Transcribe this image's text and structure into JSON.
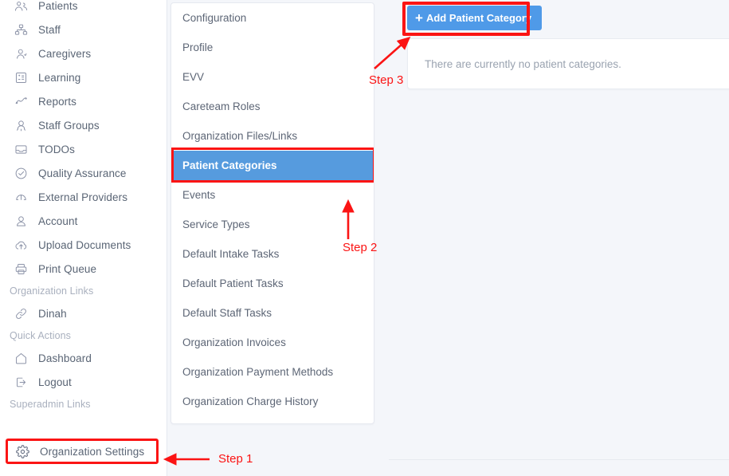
{
  "sidebar": {
    "items": [
      {
        "label": "Patients",
        "icon": "patients-icon"
      },
      {
        "label": "Staff",
        "icon": "staff-icon"
      },
      {
        "label": "Caregivers",
        "icon": "caregivers-icon"
      },
      {
        "label": "Learning",
        "icon": "learning-icon"
      },
      {
        "label": "Reports",
        "icon": "reports-icon"
      },
      {
        "label": "Staff Groups",
        "icon": "staff-groups-icon"
      },
      {
        "label": "TODOs",
        "icon": "todos-icon"
      },
      {
        "label": "Quality Assurance",
        "icon": "quality-assurance-icon"
      },
      {
        "label": "External Providers",
        "icon": "external-providers-icon"
      },
      {
        "label": "Account",
        "icon": "account-icon"
      },
      {
        "label": "Upload Documents",
        "icon": "upload-documents-icon"
      },
      {
        "label": "Print Queue",
        "icon": "print-queue-icon"
      }
    ],
    "organization_links_header": "Organization Links",
    "organization_links": [
      {
        "label": "Dinah",
        "icon": "link-icon"
      }
    ],
    "quick_actions_header": "Quick Actions",
    "quick_actions": [
      {
        "label": "Dashboard",
        "icon": "home-icon"
      },
      {
        "label": "Logout",
        "icon": "logout-icon"
      }
    ],
    "superadmin_header": "Superadmin Links",
    "superadmin": [
      {
        "label": "Organization Settings",
        "icon": "gear-icon"
      }
    ]
  },
  "settings_menu": {
    "items": [
      {
        "label": "Configuration",
        "active": false
      },
      {
        "label": "Profile",
        "active": false
      },
      {
        "label": "EVV",
        "active": false
      },
      {
        "label": "Careteam Roles",
        "active": false
      },
      {
        "label": "Organization Files/Links",
        "active": false
      },
      {
        "label": "Patient Categories",
        "active": true
      },
      {
        "label": "Events",
        "active": false
      },
      {
        "label": "Service Types",
        "active": false
      },
      {
        "label": "Default Intake Tasks",
        "active": false
      },
      {
        "label": "Default Patient Tasks",
        "active": false
      },
      {
        "label": "Default Staff Tasks",
        "active": false
      },
      {
        "label": "Organization Invoices",
        "active": false
      },
      {
        "label": "Organization Payment Methods",
        "active": false
      },
      {
        "label": "Organization Charge History",
        "active": false
      }
    ]
  },
  "content": {
    "add_button_label": "Add Patient Category",
    "add_button_icon": "plus-icon",
    "empty_message": "There are currently no patient categories."
  },
  "annotations": [
    {
      "label": "Step 1"
    },
    {
      "label": "Step 2"
    },
    {
      "label": "Step 3"
    }
  ],
  "colors": {
    "accent_blue": "#4f9ae8",
    "active_item_blue": "#569bde",
    "annotation_red": "#fb1414",
    "page_background": "#f4f6fa",
    "panel_white": "#ffffff"
  }
}
